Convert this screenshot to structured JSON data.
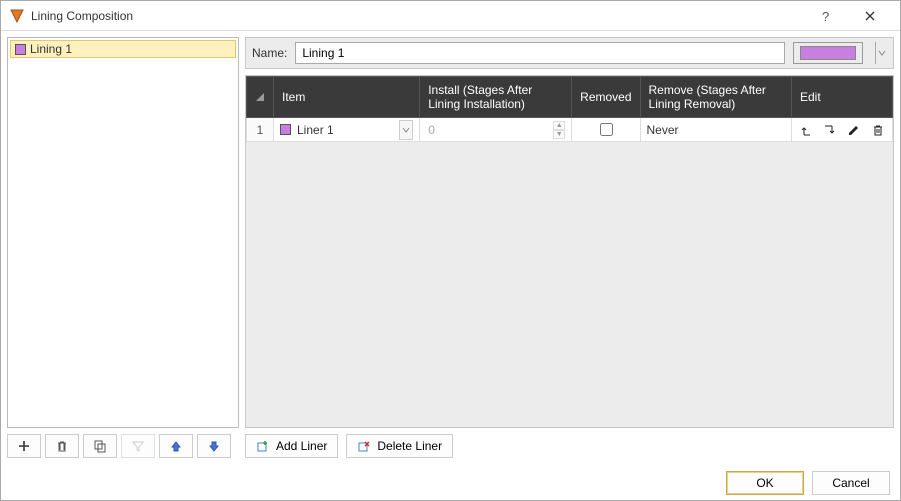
{
  "window": {
    "title": "Lining Composition"
  },
  "sidebar": {
    "items": [
      {
        "label": "Lining 1",
        "color": "#c77fe0",
        "selected": true
      }
    ]
  },
  "name_field": {
    "label": "Name:",
    "value": "Lining 1",
    "color": "#c77fe0"
  },
  "grid": {
    "headers": {
      "item": "Item",
      "install": "Install (Stages After Lining Installation)",
      "removed": "Removed",
      "remove": "Remove (Stages After Lining Removal)",
      "edit": "Edit"
    },
    "rows": [
      {
        "index": "1",
        "item_label": "Liner 1",
        "item_color": "#c77fe0",
        "install": "0",
        "removed": false,
        "remove": "Never"
      }
    ]
  },
  "liner_buttons": {
    "add": "Add Liner",
    "delete": "Delete Liner"
  },
  "footer": {
    "ok": "OK",
    "cancel": "Cancel"
  }
}
